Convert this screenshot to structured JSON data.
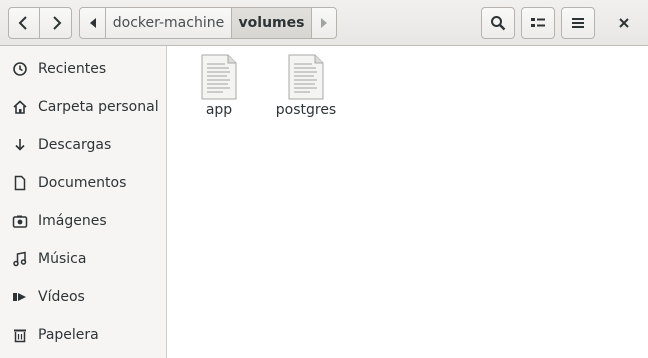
{
  "header": {
    "breadcrumbs": [
      "docker-machine",
      "volumes"
    ]
  },
  "sidebar": {
    "items": [
      {
        "label": "Recientes",
        "icon": "clock-icon"
      },
      {
        "label": "Carpeta personal",
        "icon": "home-icon"
      },
      {
        "label": "Descargas",
        "icon": "download-icon"
      },
      {
        "label": "Documentos",
        "icon": "document-icon"
      },
      {
        "label": "Imágenes",
        "icon": "camera-icon"
      },
      {
        "label": "Música",
        "icon": "music-icon"
      },
      {
        "label": "Vídeos",
        "icon": "video-icon"
      },
      {
        "label": "Papelera",
        "icon": "trash-icon"
      }
    ]
  },
  "files": [
    {
      "name": "app",
      "icon": "text-file-icon"
    },
    {
      "name": "postgres",
      "icon": "text-file-icon"
    }
  ]
}
